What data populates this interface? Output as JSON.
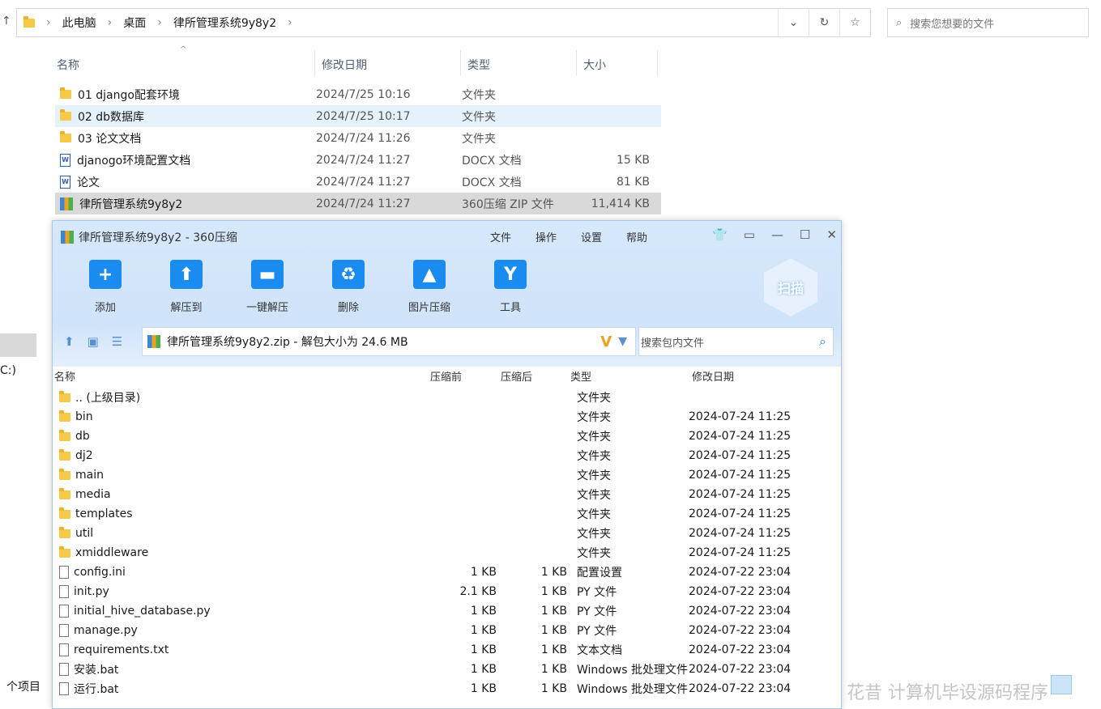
{
  "explorer": {
    "breadcrumb": [
      "此电脑",
      "桌面",
      "律所管理系统9y8y2"
    ],
    "search_placeholder": "搜索您想要的文件",
    "columns": [
      "名称",
      "修改日期",
      "类型",
      "大小"
    ],
    "rows": [
      {
        "name": "01 django配套环境",
        "date": "2024/7/25 10:16",
        "type": "文件夹",
        "size": "",
        "icon": "folder"
      },
      {
        "name": "02 db数据库",
        "date": "2024/7/25 10:17",
        "type": "文件夹",
        "size": "",
        "icon": "folder"
      },
      {
        "name": "03 论文文档",
        "date": "2024/7/24 11:26",
        "type": "文件夹",
        "size": "",
        "icon": "folder"
      },
      {
        "name": "djanogo环境配置文档",
        "date": "2024/7/24 11:27",
        "type": "DOCX 文档",
        "size": "15 KB",
        "icon": "word"
      },
      {
        "name": "论文",
        "date": "2024/7/24 11:27",
        "type": "DOCX 文档",
        "size": "81 KB",
        "icon": "word"
      },
      {
        "name": "律所管理系统9y8y2",
        "date": "2024/7/24 11:27",
        "type": "360压缩 ZIP 文件",
        "size": "11,414 KB",
        "icon": "zip"
      }
    ],
    "drive_label": "C:)",
    "status": "个项目"
  },
  "zip": {
    "title": "律所管理系统9y8y2 - 360压缩",
    "menu": [
      "文件",
      "操作",
      "设置",
      "帮助"
    ],
    "toolbar": [
      "添加",
      "解压到",
      "一键解压",
      "删除",
      "图片压缩",
      "工具"
    ],
    "scan": "扫描",
    "path": "律所管理系统9y8y2.zip - 解包大小为 24.6 MB",
    "search_placeholder": "搜索包内文件",
    "columns": [
      "名称",
      "压缩前",
      "压缩后",
      "类型",
      "修改日期"
    ],
    "rows": [
      {
        "name": ".. (上级目录)",
        "before": "",
        "after": "",
        "type": "文件夹",
        "date": "",
        "icon": "folder"
      },
      {
        "name": "bin",
        "before": "",
        "after": "",
        "type": "文件夹",
        "date": "2024-07-24 11:25",
        "icon": "folder"
      },
      {
        "name": "db",
        "before": "",
        "after": "",
        "type": "文件夹",
        "date": "2024-07-24 11:25",
        "icon": "folder"
      },
      {
        "name": "dj2",
        "before": "",
        "after": "",
        "type": "文件夹",
        "date": "2024-07-24 11:25",
        "icon": "folder"
      },
      {
        "name": "main",
        "before": "",
        "after": "",
        "type": "文件夹",
        "date": "2024-07-24 11:25",
        "icon": "folder"
      },
      {
        "name": "media",
        "before": "",
        "after": "",
        "type": "文件夹",
        "date": "2024-07-24 11:25",
        "icon": "folder"
      },
      {
        "name": "templates",
        "before": "",
        "after": "",
        "type": "文件夹",
        "date": "2024-07-24 11:25",
        "icon": "folder"
      },
      {
        "name": "util",
        "before": "",
        "after": "",
        "type": "文件夹",
        "date": "2024-07-24 11:25",
        "icon": "folder"
      },
      {
        "name": "xmiddleware",
        "before": "",
        "after": "",
        "type": "文件夹",
        "date": "2024-07-24 11:25",
        "icon": "folder"
      },
      {
        "name": "config.ini",
        "before": "1 KB",
        "after": "1 KB",
        "type": "配置设置",
        "date": "2024-07-22 23:04",
        "icon": "file"
      },
      {
        "name": "init.py",
        "before": "2.1 KB",
        "after": "1 KB",
        "type": "PY 文件",
        "date": "2024-07-22 23:04",
        "icon": "file"
      },
      {
        "name": "initial_hive_database.py",
        "before": "1 KB",
        "after": "1 KB",
        "type": "PY 文件",
        "date": "2024-07-22 23:04",
        "icon": "file"
      },
      {
        "name": "manage.py",
        "before": "1 KB",
        "after": "1 KB",
        "type": "PY 文件",
        "date": "2024-07-22 23:04",
        "icon": "file"
      },
      {
        "name": "requirements.txt",
        "before": "1 KB",
        "after": "1 KB",
        "type": "文本文档",
        "date": "2024-07-22 23:04",
        "icon": "file"
      },
      {
        "name": "安装.bat",
        "before": "1 KB",
        "after": "1 KB",
        "type": "Windows 批处理文件",
        "date": "2024-07-22 23:04",
        "icon": "file"
      },
      {
        "name": "运行.bat",
        "before": "1 KB",
        "after": "1 KB",
        "type": "Windows 批处理文件",
        "date": "2024-07-22 23:04",
        "icon": "file"
      }
    ]
  },
  "watermark": "花昔 计算机毕设源码程序"
}
